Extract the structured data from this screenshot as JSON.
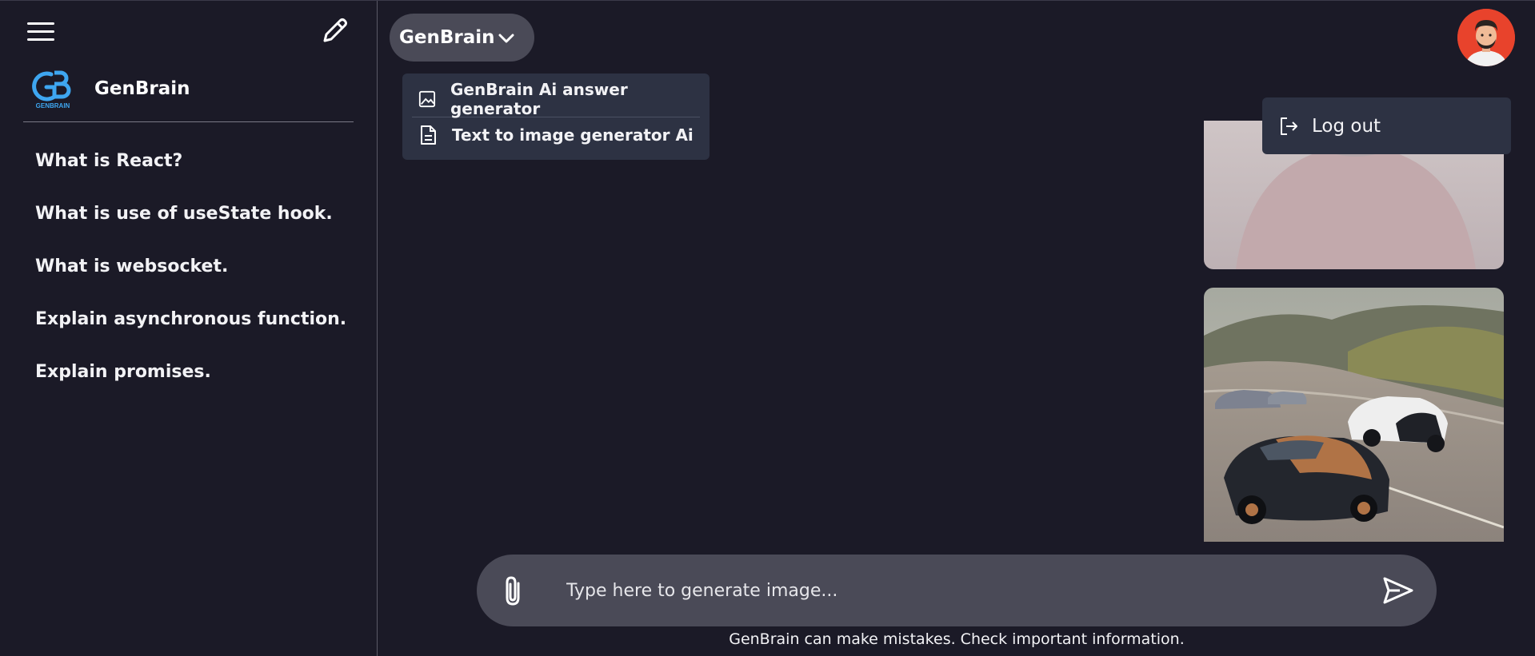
{
  "sidebar": {
    "brand": {
      "name": "GenBrain",
      "logo_text": "GENBRAIN"
    },
    "history": [
      {
        "label": "What is React?"
      },
      {
        "label": "What is use of useState hook."
      },
      {
        "label": "What is websocket."
      },
      {
        "label": "Explain asynchronous function."
      },
      {
        "label": "Explain promises."
      }
    ]
  },
  "header": {
    "model_selector": {
      "label": "GenBrain",
      "icon": "chevron-down-icon"
    },
    "model_menu": [
      {
        "label": "GenBrain Ai answer generator",
        "icon": "image-icon"
      },
      {
        "label": "Text to image generator Ai",
        "icon": "document-icon"
      }
    ]
  },
  "user_menu": {
    "logout_label": "Log out",
    "icon": "logout-icon"
  },
  "prompt": {
    "placeholder": "Type here to generate image...",
    "value": ""
  },
  "footer": {
    "disclaimer": "GenBrain can make mistakes. Check important information."
  },
  "colors": {
    "background": "#1b1a27",
    "panel": "#2d3243",
    "input": "#4a4a57",
    "accent_blue": "#3ea6f0",
    "avatar_bg": "#e8432c"
  }
}
